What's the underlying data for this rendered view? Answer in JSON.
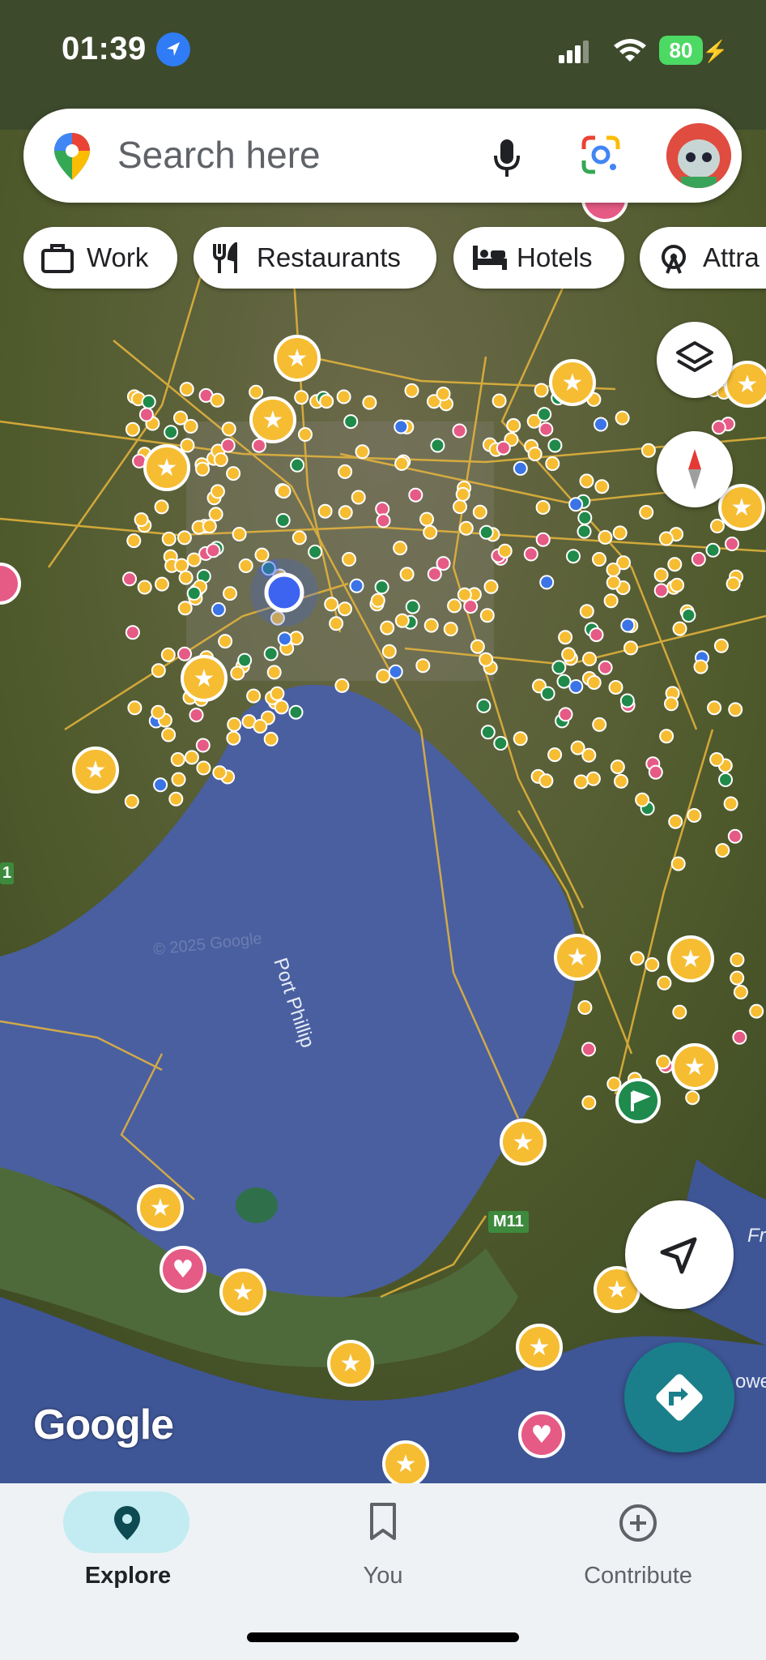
{
  "status_bar": {
    "time": "01:39",
    "battery": "80"
  },
  "search": {
    "placeholder": "Search here"
  },
  "chips": [
    {
      "label": "Work",
      "icon": "briefcase-icon"
    },
    {
      "label": "Restaurants",
      "icon": "fork-knife-icon"
    },
    {
      "label": "Hotels",
      "icon": "bed-icon"
    },
    {
      "label": "Attra",
      "icon": "ferris-wheel-icon"
    }
  ],
  "map": {
    "water_label": "Port Phillip",
    "road_label": "M11",
    "watermark": "© 2025 Google",
    "edge_labels": [
      "Fr",
      "owe",
      "1"
    ],
    "logo": "Google",
    "colors": {
      "water": "#4a5fa0",
      "land": "#55602f",
      "road": "#e8b63c",
      "yellow_poi": "#f6bd33",
      "pink_poi": "#e65a86",
      "green_poi": "#1f8a4a",
      "blue_poi": "#3a74e6",
      "current_location": "#3d64f0"
    }
  },
  "controls": {
    "layers": "layers-icon",
    "compass": "compass-icon",
    "my_location": "navigation-arrow-icon",
    "directions": "directions-icon"
  },
  "bottom_nav": [
    {
      "label": "Explore",
      "icon": "map-pin-icon",
      "active": true
    },
    {
      "label": "You",
      "icon": "bookmark-icon",
      "active": false
    },
    {
      "label": "Contribute",
      "icon": "plus-circle-icon",
      "active": false
    }
  ]
}
